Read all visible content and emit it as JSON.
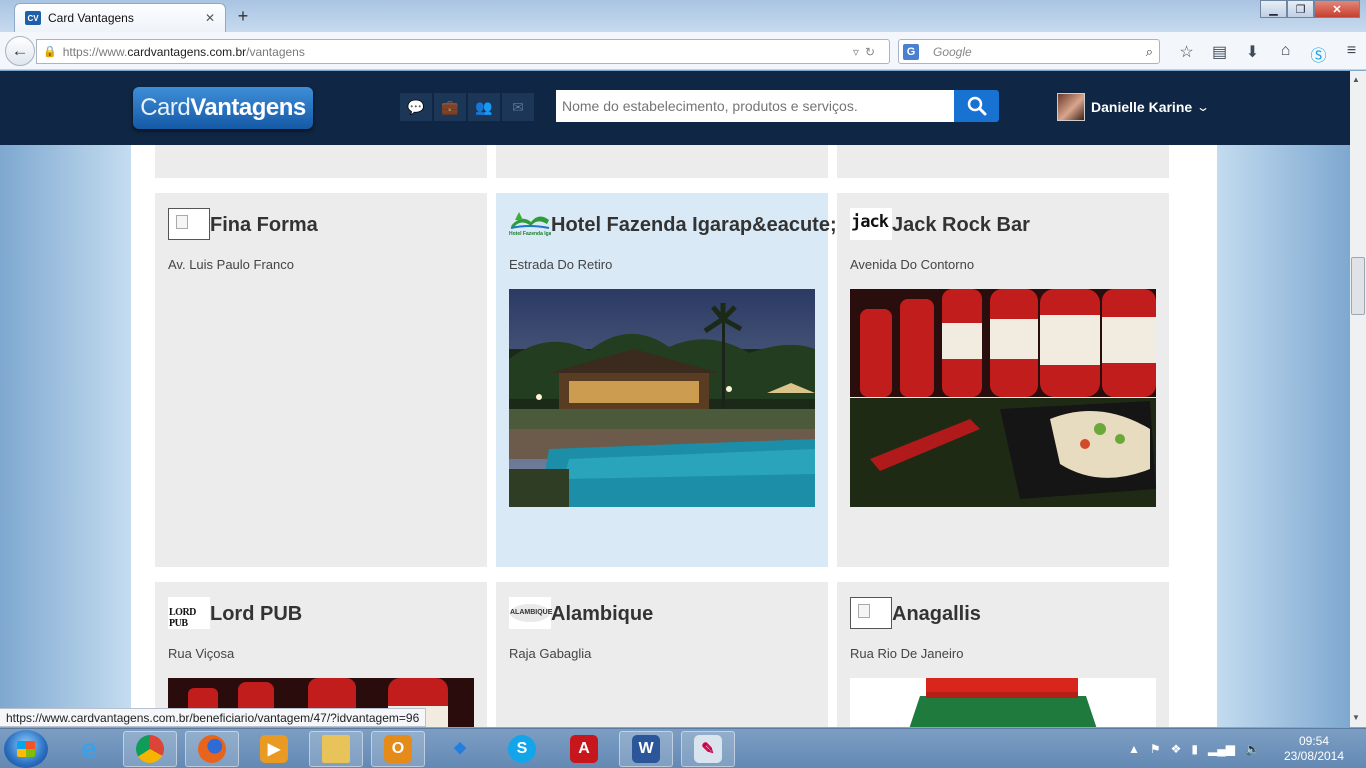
{
  "browser": {
    "tab_title": "Card Vantagens",
    "tab_favicon": "CV",
    "url_prefix": "https://www.",
    "url_domain": "cardvantagens.com.br",
    "url_path": "/vantagens",
    "search_engine": "G",
    "search_placeholder": "Google",
    "status_link": "https://www.cardvantagens.com.br/beneficiario/vantagem/47/?idvantagem=96"
  },
  "site": {
    "logo_part1": "Card",
    "logo_part2": "Vantagens",
    "search_placeholder": "Nome do estabelecimento, produtos e serviços.",
    "user_name": "Danielle Karine",
    "header_icons": [
      "chat-icon",
      "briefcase-icon",
      "users-icon",
      "mail-icon"
    ]
  },
  "establishments": [
    {
      "name": "Fina Forma",
      "address": "Av. Luis Paulo Franco",
      "logo": "placeholder"
    },
    {
      "name": "Hotel Fazenda Igarap&eacute;s",
      "address": "Estrada Do Retiro",
      "logo": "Hotel Fazenda Igarapés",
      "highlighted": true
    },
    {
      "name": "Jack Rock Bar",
      "address": "Avenida Do Contorno",
      "logo": "jack"
    },
    {
      "name": "Lord PUB",
      "address": "Rua Viçosa",
      "logo": "LORD PUB"
    },
    {
      "name": "Alambique",
      "address": "Raja Gabaglia",
      "logo": "ALAMBIQUE"
    },
    {
      "name": "Anagallis",
      "address": "Rua Rio De Janeiro",
      "logo": "placeholder"
    }
  ],
  "taskbar": {
    "apps": [
      "internet-explorer",
      "chrome",
      "firefox",
      "media-player",
      "file-explorer",
      "outlook",
      "dropbox",
      "skype",
      "acrobat",
      "word",
      "paint"
    ],
    "time": "09:54",
    "date": "23/08/2014"
  },
  "colors": {
    "header_bg": "#0f2744",
    "accent": "#1772d2",
    "card_bg": "#ececec",
    "card_highlight": "#d9eaf6"
  }
}
